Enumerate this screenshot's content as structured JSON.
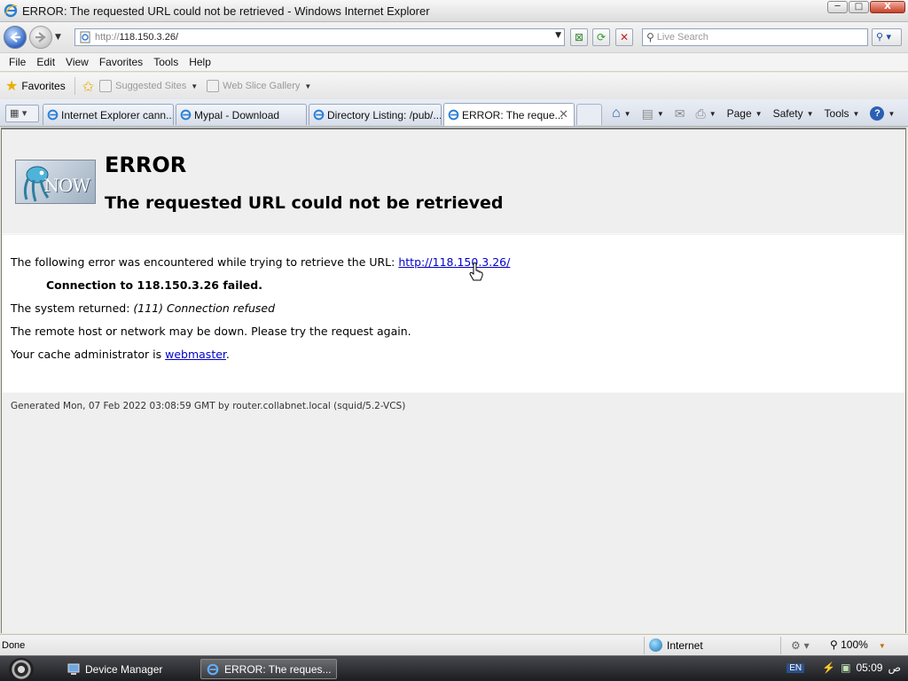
{
  "window": {
    "title": "ERROR: The requested URL could not be retrieved - Windows Internet Explorer",
    "minimize": "─",
    "maximize": "□",
    "close": "X"
  },
  "address_bar": {
    "url_prefix": "http://",
    "url_host": "118.150.3.26/"
  },
  "search": {
    "placeholder": "Live Search"
  },
  "menu": [
    "File",
    "Edit",
    "View",
    "Favorites",
    "Tools",
    "Help"
  ],
  "favorites_bar": {
    "favorites_label": "Favorites",
    "suggested_sites": "Suggested Sites",
    "web_slice_gallery": "Web Slice Gallery"
  },
  "tabs": [
    {
      "label": "Internet Explorer cann...",
      "active": false
    },
    {
      "label": "Mypal - Download",
      "active": false
    },
    {
      "label": "Directory Listing: /pub/...",
      "active": false
    },
    {
      "label": "ERROR: The reque...",
      "active": true
    }
  ],
  "command_bar": {
    "page": "Page",
    "safety": "Safety",
    "tools": "Tools",
    "help": "?"
  },
  "page": {
    "logo_text": "NOW",
    "heading": "ERROR",
    "subheading": "The requested URL could not be retrieved",
    "line1_text": "The following error was encountered while trying to retrieve the URL: ",
    "line1_link": "http://118.150.3.26/",
    "line2": "Connection to 118.150.3.26 failed.",
    "line3_text": "The system returned: ",
    "line3_italic": "(111) Connection refused",
    "line4": "The remote host or network may be down. Please try the request again.",
    "line5_text": "Your cache administrator is ",
    "line5_link": "webmaster",
    "line5_end": ".",
    "footer": "Generated Mon, 07 Feb 2022 03:08:59 GMT by router.collabnet.local (squid/5.2-VCS)"
  },
  "status_bar": {
    "status": "Done",
    "zone": "Internet",
    "zoom": "100%"
  },
  "taskbar": {
    "items": [
      {
        "label": "Device Manager"
      },
      {
        "label": "ERROR: The reques..."
      }
    ],
    "language": "EN",
    "time": "05:09",
    "ampm": "ص"
  },
  "colors": {
    "link": "#0000cc",
    "content_bg": "#efefef",
    "body_bg": "#ffffff",
    "taskbar": "#2a2b2e"
  }
}
